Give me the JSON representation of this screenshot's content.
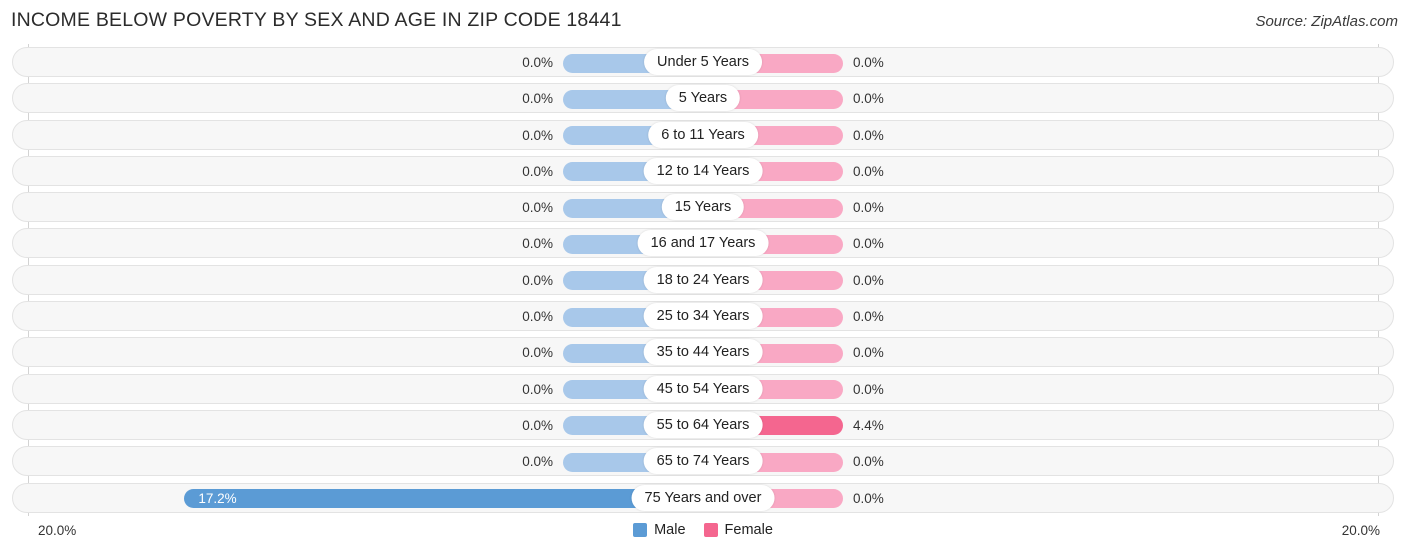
{
  "header": {
    "title": "INCOME BELOW POVERTY BY SEX AND AGE IN ZIP CODE 18441",
    "source": "Source: ZipAtlas.com"
  },
  "legend": {
    "male_label": "Male",
    "female_label": "Female",
    "male_color": "#5b9bd5",
    "female_color": "#f4668f"
  },
  "axis": {
    "left_max": "20.0%",
    "right_max": "20.0%"
  },
  "chart_data": {
    "type": "bar",
    "subtype": "diverging-horizontal-bar",
    "title": "INCOME BELOW POVERTY BY SEX AND AGE IN ZIP CODE 18441",
    "xlabel": "",
    "ylabel": "",
    "xlim": [
      20.0,
      20.0
    ],
    "axis_max_left": 20.0,
    "axis_max_right": 20.0,
    "unit": "%",
    "grid": false,
    "legend_position": "bottom-center",
    "categories": [
      "Under 5 Years",
      "5 Years",
      "6 to 11 Years",
      "12 to 14 Years",
      "15 Years",
      "16 and 17 Years",
      "18 to 24 Years",
      "25 to 34 Years",
      "35 to 44 Years",
      "45 to 54 Years",
      "55 to 64 Years",
      "65 to 74 Years",
      "75 Years and over"
    ],
    "series": [
      {
        "name": "Male",
        "direction": "left",
        "color": "#5b9bd5",
        "values": [
          0.0,
          0.0,
          0.0,
          0.0,
          0.0,
          0.0,
          0.0,
          0.0,
          0.0,
          0.0,
          0.0,
          0.0,
          17.2
        ],
        "labels": [
          "0.0%",
          "0.0%",
          "0.0%",
          "0.0%",
          "0.0%",
          "0.0%",
          "0.0%",
          "0.0%",
          "0.0%",
          "0.0%",
          "0.0%",
          "0.0%",
          "17.2%"
        ]
      },
      {
        "name": "Female",
        "direction": "right",
        "color": "#f4668f",
        "values": [
          0.0,
          0.0,
          0.0,
          0.0,
          0.0,
          0.0,
          0.0,
          0.0,
          0.0,
          0.0,
          4.4,
          0.0,
          0.0
        ],
        "labels": [
          "0.0%",
          "0.0%",
          "0.0%",
          "0.0%",
          "0.0%",
          "0.0%",
          "0.0%",
          "0.0%",
          "0.0%",
          "0.0%",
          "4.4%",
          "0.0%",
          "0.0%"
        ]
      }
    ]
  }
}
